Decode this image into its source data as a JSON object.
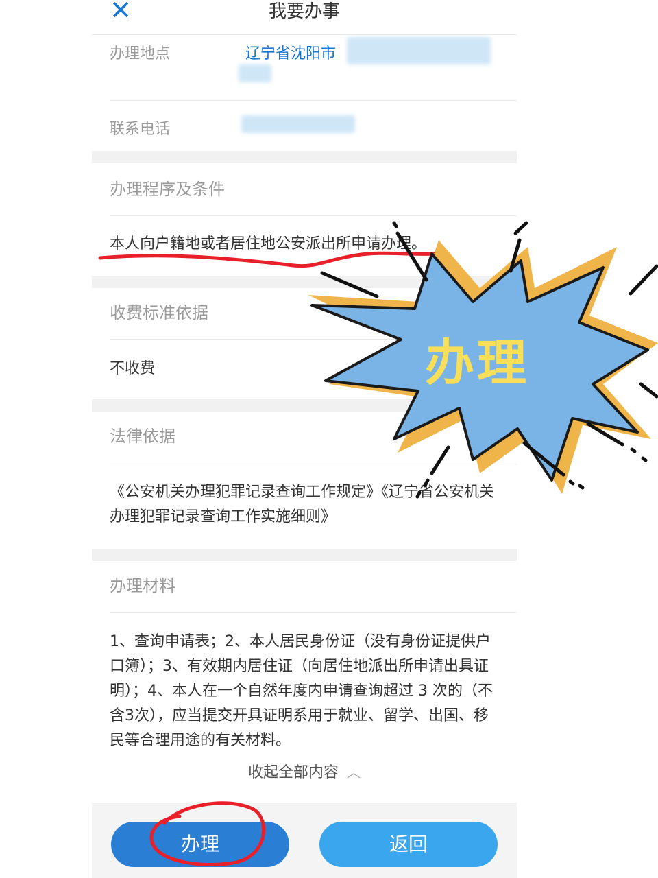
{
  "header": {
    "title": "我要办事",
    "close_icon": "close-icon"
  },
  "info": {
    "location_label": "办理地点",
    "location_value": "辽宁省沈阳市",
    "phone_label": "联系电话"
  },
  "sections": {
    "procedure": {
      "title": "办理程序及条件",
      "body": "本人向户籍地或者居住地公安派出所申请办理。"
    },
    "fee": {
      "title": "收费标准依据",
      "body": "不收费"
    },
    "legal": {
      "title": "法律依据",
      "body": "《公安机关办理犯罪记录查询工作规定》《辽宁省公安机关办理犯罪记录查询工作实施细则》"
    },
    "materials": {
      "title": "办理材料",
      "body": "1、查询申请表；2、本人居民身份证（没有身份证提供户口簿）；3、有效期内居住证（向居住地派出所申请出具证明）；4、本人在一个自然年度内申请查询超过 3 次的（不含3次），应当提交开具证明系用于就业、留学、出国、移民等合理用途的有关材料。"
    }
  },
  "collapse": {
    "label": "收起全部内容",
    "icon": "chevron-up-icon"
  },
  "actions": {
    "primary_label": "办理",
    "secondary_label": "返回"
  },
  "annotation": {
    "burst_text": "办理"
  },
  "colors": {
    "accent": "#1976d2",
    "primary_button": "#2a7fd4",
    "secondary_button": "#3aa6ee",
    "burst_fill": "#7ab3e6",
    "burst_shadow": "#f0b54a",
    "burst_text": "#f8df5a",
    "annotation_red": "#e8202a"
  }
}
